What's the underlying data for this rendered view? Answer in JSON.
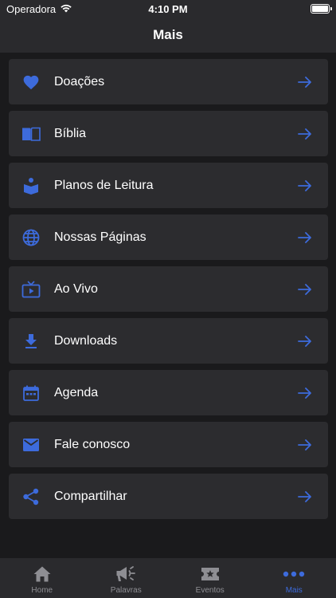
{
  "status_bar": {
    "carrier": "Operadora",
    "time": "4:10 PM"
  },
  "header": {
    "title": "Mais"
  },
  "colors": {
    "accent": "#3d6bdc",
    "background": "#1a1a1c",
    "card": "#2c2c2f",
    "bar": "#2a2a2d",
    "tab_inactive": "#8e8e93"
  },
  "menu": {
    "items": [
      {
        "label": "Doações",
        "icon": "heart-icon"
      },
      {
        "label": "Bíblia",
        "icon": "book-icon"
      },
      {
        "label": "Planos de Leitura",
        "icon": "reading-plan-icon"
      },
      {
        "label": "Nossas Páginas",
        "icon": "globe-icon"
      },
      {
        "label": "Ao Vivo",
        "icon": "live-tv-icon"
      },
      {
        "label": "Downloads",
        "icon": "download-icon"
      },
      {
        "label": "Agenda",
        "icon": "calendar-icon"
      },
      {
        "label": "Fale conosco",
        "icon": "mail-icon"
      },
      {
        "label": "Compartilhar",
        "icon": "share-icon"
      }
    ]
  },
  "tabs": [
    {
      "label": "Home",
      "icon": "home-icon",
      "active": false
    },
    {
      "label": "Palavras",
      "icon": "megaphone-icon",
      "active": false
    },
    {
      "label": "Eventos",
      "icon": "ticket-icon",
      "active": false
    },
    {
      "label": "Mais",
      "icon": "more-icon",
      "active": true
    }
  ]
}
